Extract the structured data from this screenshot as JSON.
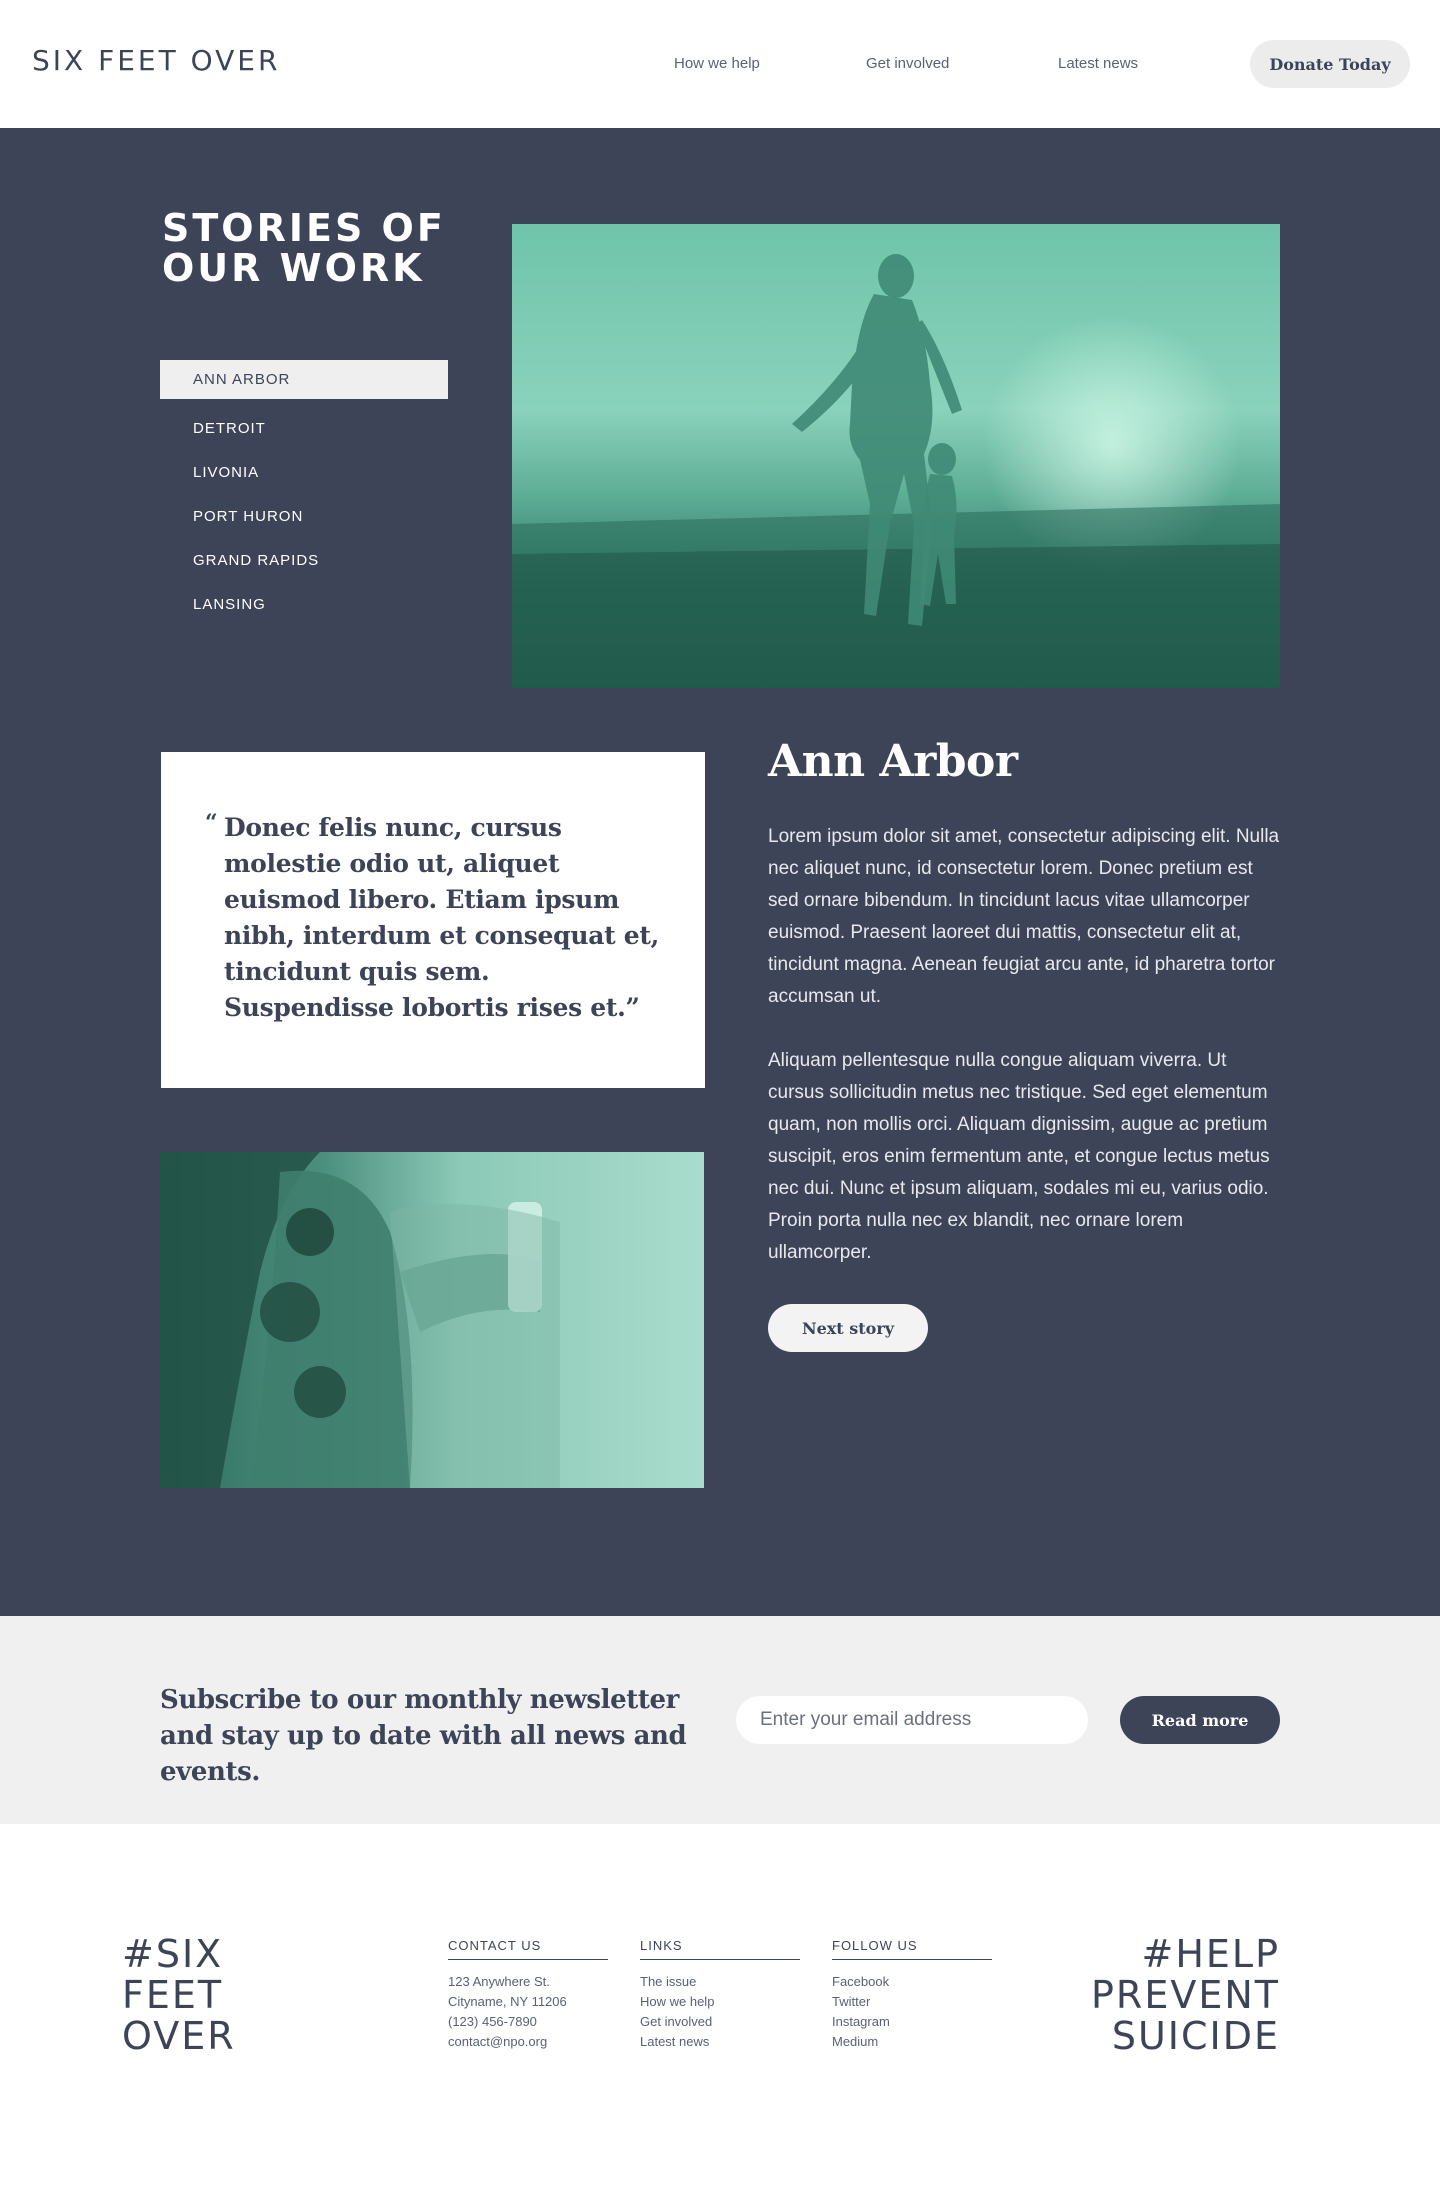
{
  "header": {
    "logo": "SIX FEET OVER",
    "nav": [
      "How we help",
      "Get involved",
      "Latest news"
    ],
    "donate_label": "Donate Today"
  },
  "stories": {
    "title": "STORIES OF OUR WORK",
    "cities": [
      "ANN ARBOR",
      "DETROIT",
      "LIVONIA",
      "PORT HURON",
      "GRAND RAPIDS",
      "LANSING"
    ],
    "active_city": "ANN ARBOR",
    "quote_mark": "“",
    "quote": "Donec felis nunc, cursus molestie odio ut, aliquet euismod libero. Etiam ipsum nibh, interdum et consequat et, tincidunt quis sem. Suspendisse lobortis rises et.”",
    "heading": "Ann Arbor",
    "paragraphs": [
      "Lorem ipsum dolor sit amet, consectetur adipiscing elit. Nulla nec aliquet nunc, id consectetur lorem. Donec pretium est sed ornare bibendum. In tincidunt lacus vitae ullamcorper euismod. Praesent laoreet dui mattis, consectetur elit at, tincidunt magna. Aenean feugiat arcu ante, id pharetra tortor accumsan ut.",
      "Aliquam pellentesque nulla congue aliquam viverra. Ut cursus sollicitudin metus nec tristique. Sed eget elementum quam, non mollis orci. Aliquam dignissim, augue ac pretium suscipit, eros enim fermentum ante, et congue lectus metus nec dui. Nunc et ipsum aliquam, sodales mi eu, varius odio. Proin porta nulla nec ex blandit, nec ornare lorem ullamcorper."
    ],
    "next_label": "Next story"
  },
  "newsletter": {
    "text": "Subscribe to our monthly newsletter and stay up to date with all news and events.",
    "email_placeholder": "Enter your email address",
    "button_label": "Read more"
  },
  "footer": {
    "logo": "#SIX FEET OVER",
    "tagline": "#HELP PREVENT SUICIDE",
    "columns": [
      {
        "title": "CONTACT US",
        "items": [
          "123 Anywhere St.",
          "Cityname, NY 11206",
          "(123) 456-7890",
          "contact@npo.org"
        ]
      },
      {
        "title": "LINKS",
        "items": [
          "The issue",
          "How we help",
          "Get involved",
          "Latest news"
        ]
      },
      {
        "title": "FOLLOW US",
        "items": [
          "Facebook",
          "Twitter",
          "Instagram",
          "Medium"
        ]
      }
    ]
  },
  "colors": {
    "navy": "#3d4457",
    "photo_tint": "#6fc4a9",
    "light_gray": "#f0f0f0"
  }
}
